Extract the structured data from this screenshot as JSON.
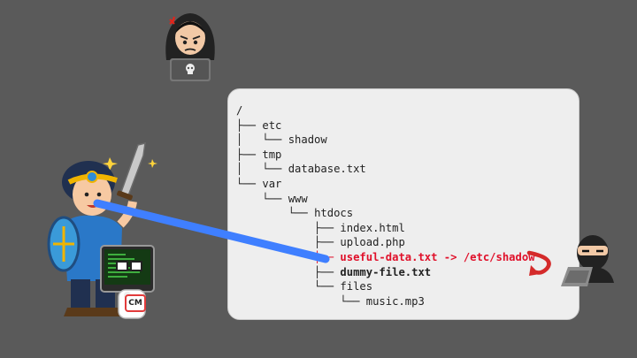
{
  "tree": {
    "lines": [
      {
        "prefix": "/",
        "name": "",
        "style": "normal"
      },
      {
        "prefix": "├── ",
        "name": "etc",
        "style": "normal"
      },
      {
        "prefix": "│   └── ",
        "name": "shadow",
        "style": "normal"
      },
      {
        "prefix": "├── ",
        "name": "tmp",
        "style": "normal"
      },
      {
        "prefix": "│   └── ",
        "name": "database.txt",
        "style": "normal"
      },
      {
        "prefix": "└── ",
        "name": "var",
        "style": "normal"
      },
      {
        "prefix": "    └── ",
        "name": "www",
        "style": "normal"
      },
      {
        "prefix": "        └── ",
        "name": "htdocs",
        "style": "normal"
      },
      {
        "prefix": "            ├── ",
        "name": "index.html",
        "style": "normal"
      },
      {
        "prefix": "            ├── ",
        "name": "upload.php",
        "style": "normal"
      },
      {
        "prefix": "            ├── ",
        "name": "useful-data.txt -> /etc/shadow",
        "style": "mal"
      },
      {
        "prefix": "            ├── ",
        "name": "dummy-file.txt",
        "style": "bold"
      },
      {
        "prefix": "            └── ",
        "name": "files",
        "style": "normal"
      },
      {
        "prefix": "                └── ",
        "name": "music.mp3",
        "style": "normal"
      }
    ]
  },
  "badge": {
    "label": "CM"
  },
  "colors": {
    "background": "#5a5a5a",
    "panel": "#eeeeee",
    "symlink_text": "#e0102a",
    "gaze_line": "#3f7fff",
    "curved_arrow": "#d42a2a"
  },
  "icons": {
    "angry_hacker": "hooded-hacker-icon",
    "sneaky_hacker": "masked-hacker-icon",
    "hero": "hero-knight-icon",
    "arrow": "curved-arrow-icon"
  }
}
